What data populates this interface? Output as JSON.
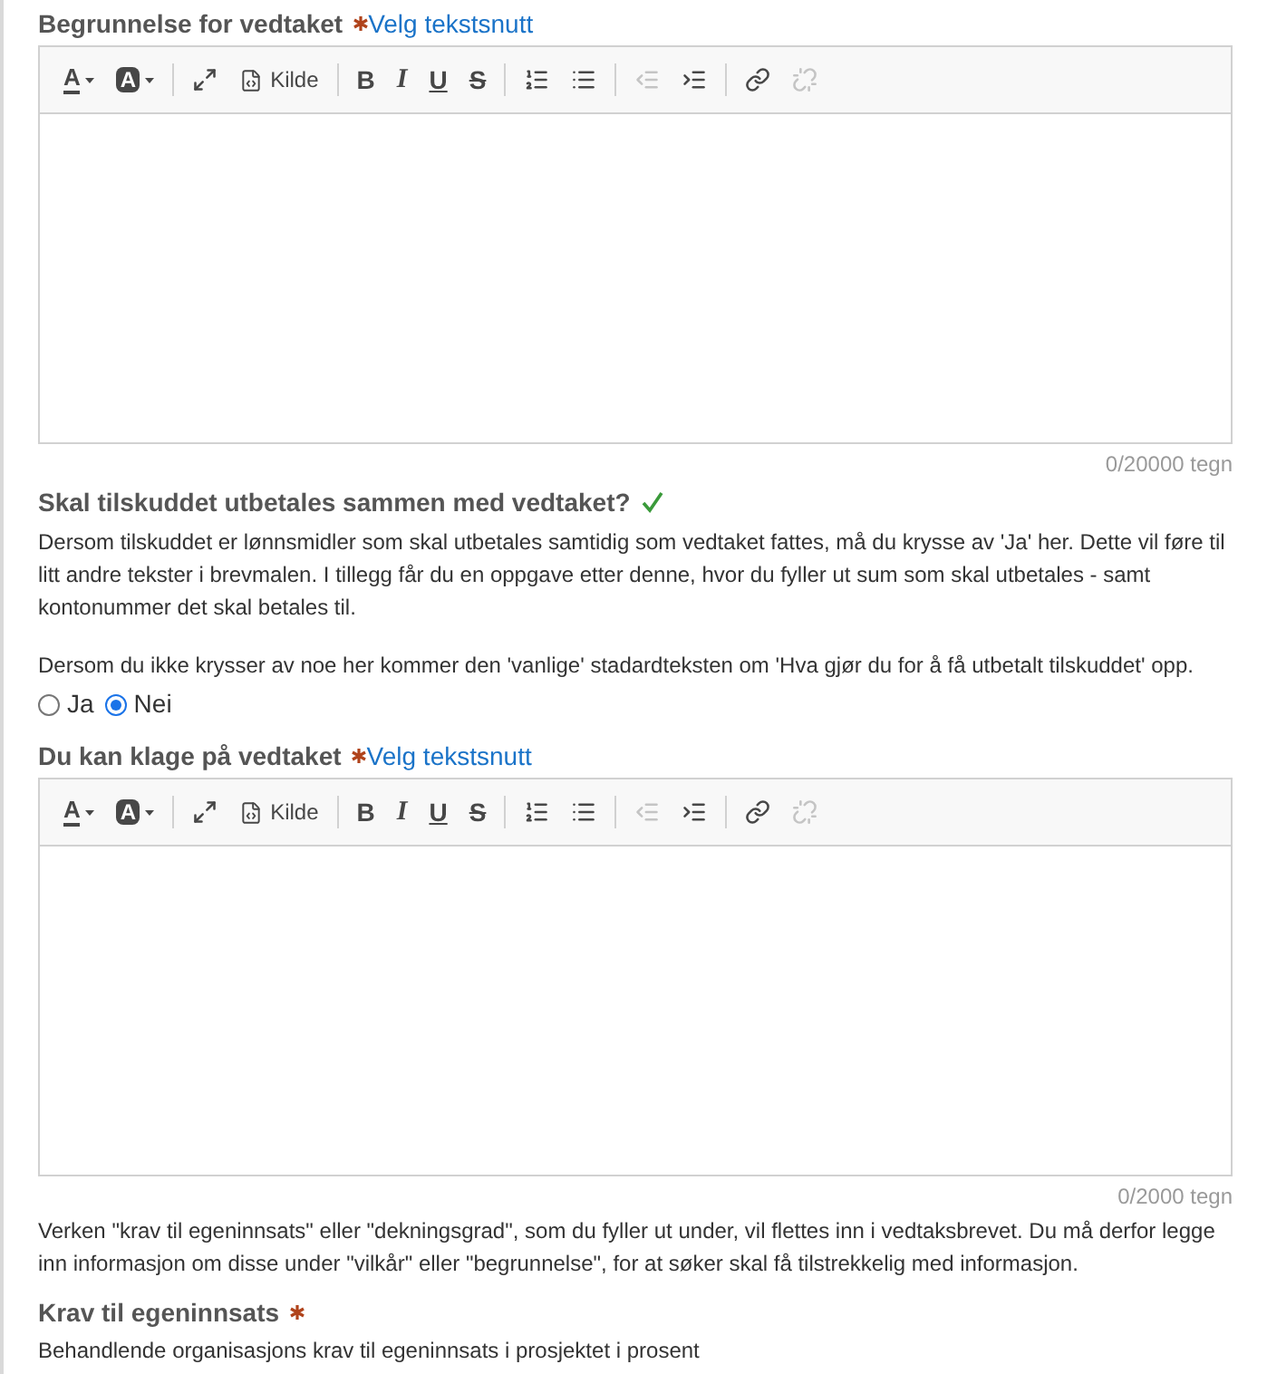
{
  "sections": [
    {
      "kind": "editor",
      "label": "Begrunnelse for vedtaket",
      "required": true,
      "link": "Velg tekstsnutt",
      "toolbar": [
        {
          "kind": "text-color",
          "label": "A",
          "disabled": false
        },
        {
          "kind": "bg-color",
          "label": "A",
          "disabled": false
        },
        {
          "kind": "separator"
        },
        {
          "kind": "maximize",
          "disabled": false
        },
        {
          "kind": "source",
          "label": "Kilde",
          "disabled": false
        },
        {
          "kind": "separator"
        },
        {
          "kind": "bold",
          "label": "B",
          "disabled": false
        },
        {
          "kind": "italic",
          "label": "I",
          "disabled": false
        },
        {
          "kind": "underline",
          "label": "U",
          "disabled": false
        },
        {
          "kind": "strike",
          "label": "S",
          "disabled": false
        },
        {
          "kind": "separator"
        },
        {
          "kind": "numbered-list",
          "disabled": false
        },
        {
          "kind": "bulleted-list",
          "disabled": false
        },
        {
          "kind": "separator"
        },
        {
          "kind": "outdent",
          "disabled": true
        },
        {
          "kind": "indent",
          "disabled": false
        },
        {
          "kind": "separator"
        },
        {
          "kind": "link",
          "disabled": false
        },
        {
          "kind": "unlink",
          "disabled": true
        }
      ],
      "counter": "0/20000 tegn"
    },
    {
      "kind": "question",
      "label": "Skal tilskuddet utbetales sammen med vedtaket?",
      "answered": true,
      "paragraphs": [
        "Dersom tilskuddet er lønnsmidler som skal utbetales samtidig som vedtaket fattes, må du krysse av 'Ja' her. Dette vil føre til litt andre tekster i brevmalen. I tillegg får du en oppgave etter denne, hvor du fyller ut sum som skal utbetales -  samt kontonummer det skal betales til.",
        "Dersom du ikke krysser av noe her kommer den 'vanlige' stadardteksten om 'Hva gjør du for å få utbetalt tilskuddet' opp."
      ],
      "options": [
        {
          "label": "Ja",
          "selected": false
        },
        {
          "label": "Nei",
          "selected": true
        }
      ]
    },
    {
      "kind": "editor",
      "label": "Du kan klage på vedtaket",
      "required": true,
      "link": "Velg tekstsnutt",
      "toolbar": [
        {
          "kind": "text-color",
          "label": "A",
          "disabled": false
        },
        {
          "kind": "bg-color",
          "label": "A",
          "disabled": false
        },
        {
          "kind": "separator"
        },
        {
          "kind": "maximize",
          "disabled": false
        },
        {
          "kind": "source",
          "label": "Kilde",
          "disabled": false
        },
        {
          "kind": "separator"
        },
        {
          "kind": "bold",
          "label": "B",
          "disabled": false
        },
        {
          "kind": "italic",
          "label": "I",
          "disabled": false
        },
        {
          "kind": "underline",
          "label": "U",
          "disabled": false
        },
        {
          "kind": "strike",
          "label": "S",
          "disabled": false
        },
        {
          "kind": "separator"
        },
        {
          "kind": "numbered-list",
          "disabled": false
        },
        {
          "kind": "bulleted-list",
          "disabled": false
        },
        {
          "kind": "separator"
        },
        {
          "kind": "outdent",
          "disabled": true
        },
        {
          "kind": "indent",
          "disabled": false
        },
        {
          "kind": "separator"
        },
        {
          "kind": "link",
          "disabled": false
        },
        {
          "kind": "unlink",
          "disabled": true
        }
      ],
      "counter": "0/2000 tegn"
    },
    {
      "kind": "info",
      "paragraphs": [
        "Verken \"krav til egeninnsats\" eller \"dekningsgrad\", som du fyller ut under, vil flettes inn i vedtaksbrevet. Du må derfor legge inn informasjon om disse under \"vilkår\" eller \"begrunnelse\", for at søker skal få tilstrekkelig med informasjon."
      ]
    },
    {
      "kind": "field",
      "label": "Krav til egeninnsats",
      "required": true,
      "help": "Behandlende organisasjons krav til egeninnsats i prosjektet i prosent"
    }
  ]
}
